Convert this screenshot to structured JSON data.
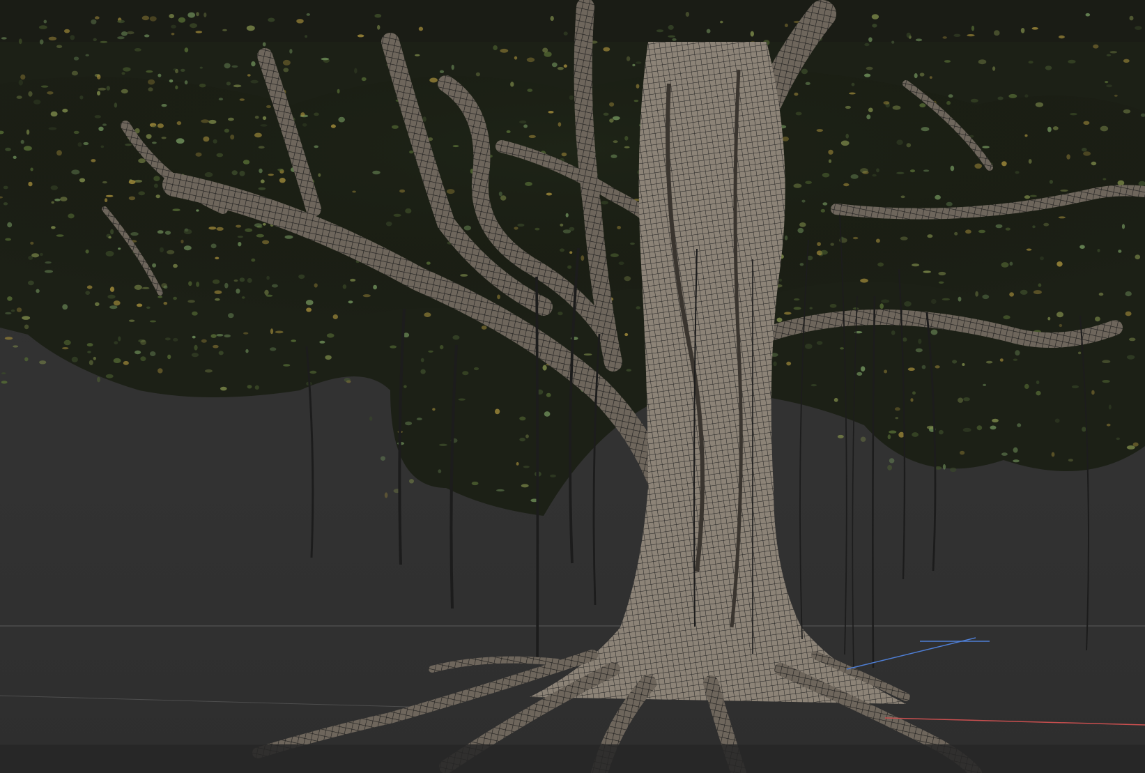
{
  "app": {
    "name": "3D viewport"
  },
  "viewport": {
    "mode": "wireframe-overlay",
    "background_color": "#303030",
    "grid_line_color": "#5a5a5a"
  },
  "scene": {
    "object": "banyan-tree-mesh",
    "foliage_colors": [
      "#3b4a2a",
      "#556b34",
      "#7d8a4a",
      "#a08a3a",
      "#6f8f5a"
    ],
    "bark_color": "#6e665c",
    "wire_color": "#1c1c1c"
  },
  "axes": {
    "x_color": "#c94f4f",
    "y_color": "#4f7fd6"
  }
}
